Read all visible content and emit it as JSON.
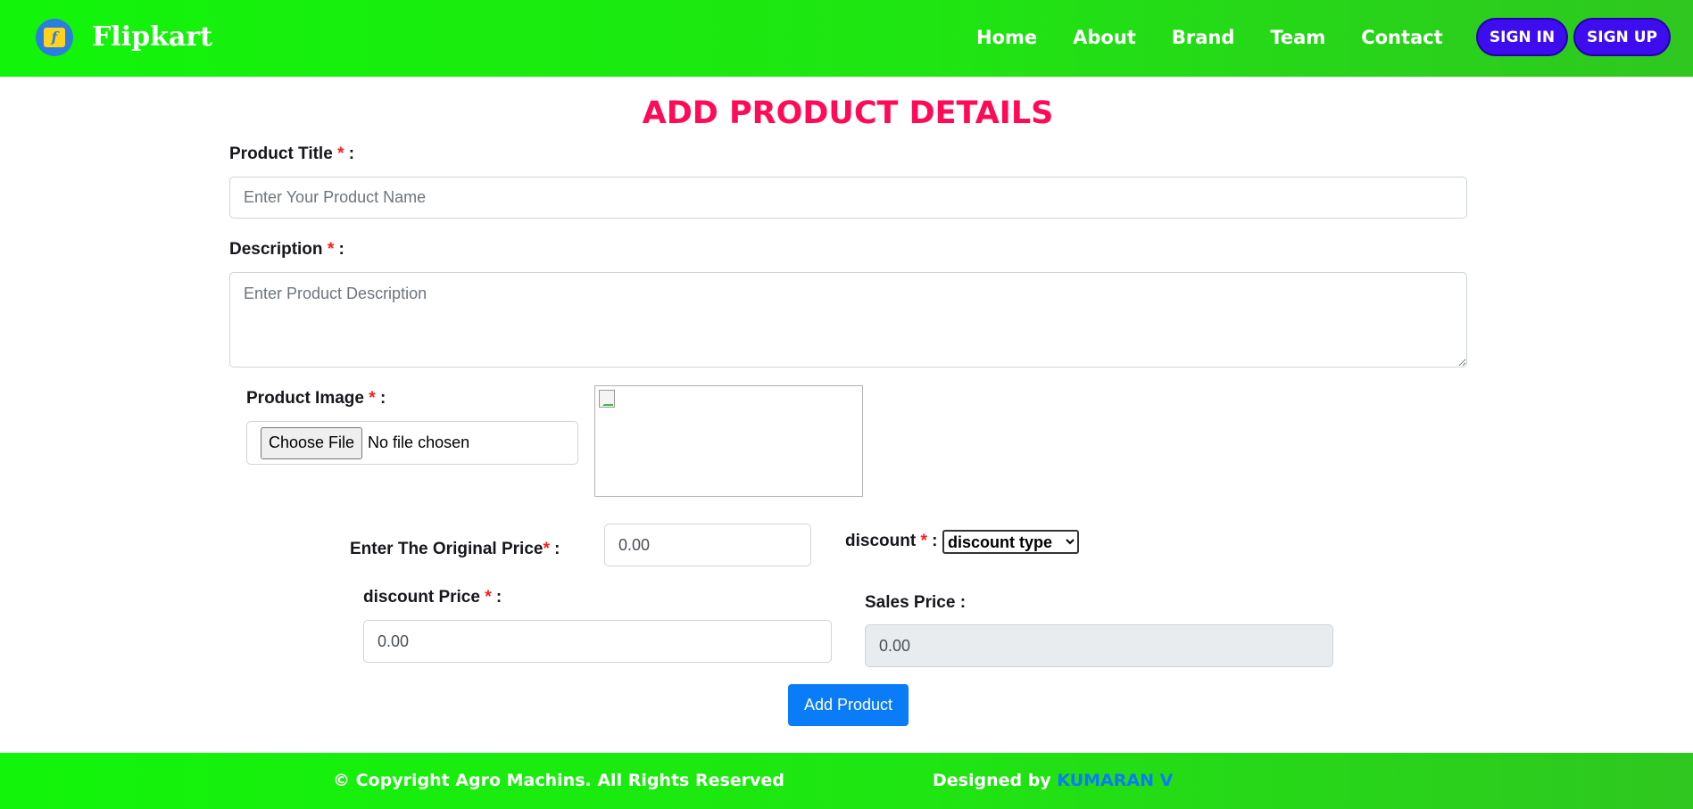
{
  "header": {
    "brand_name": "Flipkart",
    "logo_glyph": "f",
    "nav": [
      "Home",
      "About",
      "Brand",
      "Team",
      "Contact"
    ],
    "signin_label": "SIGN IN",
    "signup_label": "SIGN UP"
  },
  "form": {
    "title": "ADD PRODUCT DETAILS",
    "required_mark": "*",
    "product_title": {
      "label": "Product Title",
      "suffix": " :",
      "placeholder": "Enter Your Product Name"
    },
    "description": {
      "label": "Description",
      "suffix": " :",
      "placeholder": "Enter Product Description"
    },
    "product_image": {
      "label": "Product Image",
      "suffix": " :",
      "button": "Choose File",
      "status": "No file chosen"
    },
    "original_price": {
      "label": "Enter The Original Price",
      "suffix": " :",
      "value": "0.00"
    },
    "discount": {
      "label": "discount",
      "suffix": " :",
      "selected": "discount type"
    },
    "discount_price": {
      "label": "discount Price",
      "suffix": " :",
      "value": "0.00"
    },
    "sales_price": {
      "label": "Sales Price :",
      "value": "0.00"
    },
    "submit_label": "Add Product"
  },
  "footer": {
    "copyright": "© Copyright Agro Machins. All Rights Reserved",
    "designed_by": "Designed by",
    "designer": "KUMARAN V"
  },
  "colors": {
    "header_green": "#12f50a",
    "title_pink": "#ff0a56",
    "signin_purple": "#3d0df0",
    "primary_blue": "#0a7cf8",
    "required_red": "#ff1a1a"
  },
  "icons": {
    "logo": "shopping-bag-icon",
    "broken_image": "broken-image-icon"
  }
}
